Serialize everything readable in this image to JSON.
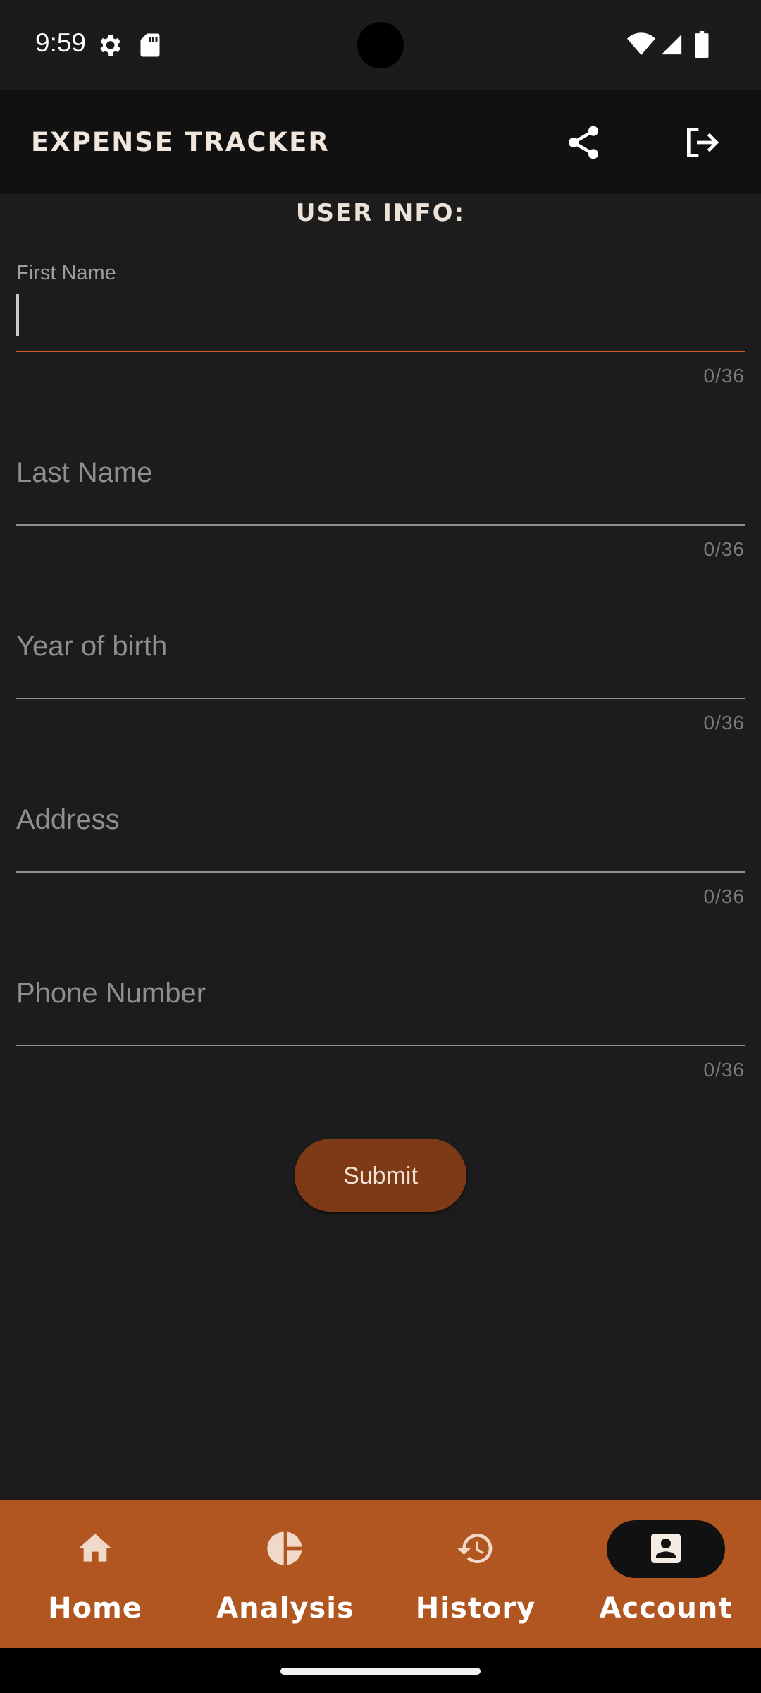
{
  "status_bar": {
    "time": "9:59"
  },
  "app_bar": {
    "title": "EXPENSE TRACKER"
  },
  "form": {
    "section_title": "USER INFO:",
    "fields": [
      {
        "label": "First Name",
        "value": "",
        "counter": "0/36",
        "focused": true
      },
      {
        "label": "Last Name",
        "value": "",
        "counter": "0/36"
      },
      {
        "label": "Year of birth",
        "value": "",
        "counter": "0/36"
      },
      {
        "label": "Address",
        "value": "",
        "counter": "0/36"
      },
      {
        "label": "Phone Number",
        "value": "",
        "counter": "0/36"
      }
    ],
    "submit_label": "Submit"
  },
  "bottom_nav": {
    "items": [
      {
        "label": "Home",
        "icon": "home-icon"
      },
      {
        "label": "Analysis",
        "icon": "pie-chart-icon"
      },
      {
        "label": "History",
        "icon": "history-icon"
      },
      {
        "label": "Account",
        "icon": "account-box-icon",
        "selected": true
      }
    ]
  },
  "colors": {
    "accent": "#b15620",
    "submit": "#7e3a16",
    "focus_underline": "#d05a2a",
    "background": "#1c1c1c"
  }
}
